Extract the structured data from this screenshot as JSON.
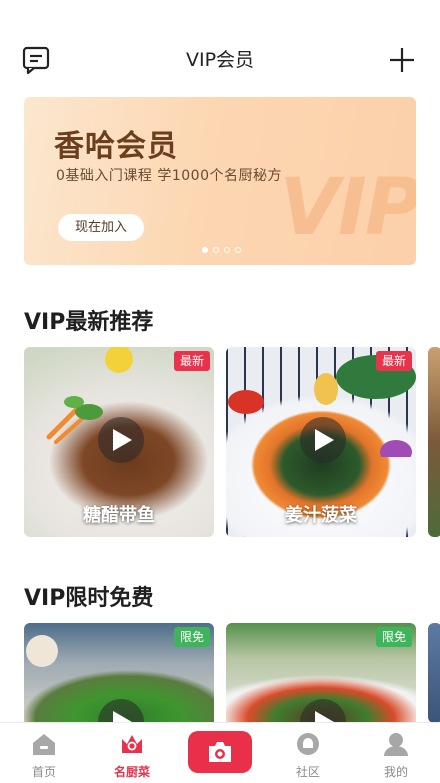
{
  "header": {
    "title": "VIP会员",
    "left_icon": "message-icon",
    "right_icon": "plus-icon"
  },
  "banner": {
    "title": "香哈会员",
    "subtitle": "0基础入门课程  学1000个名厨秘方",
    "button_label": "现在加入",
    "watermark": "VIP",
    "dots_count": 4,
    "active_dot": 0
  },
  "sections": [
    {
      "title": "VIP最新推荐",
      "cards": [
        {
          "label": "糖醋带鱼",
          "badge": "最新"
        },
        {
          "label": "姜汁菠菜",
          "badge": "最新"
        }
      ]
    },
    {
      "title": "VIP限时免费",
      "cards": [
        {
          "label": "",
          "badge": "限免"
        },
        {
          "label": "",
          "badge": "限免"
        }
      ]
    }
  ],
  "tabbar": {
    "items": [
      {
        "label": "首页",
        "icon": "home-icon"
      },
      {
        "label": "名厨菜",
        "icon": "chef-hat-icon",
        "active": true
      },
      {
        "label": "",
        "icon": "camera-icon"
      },
      {
        "label": "社区",
        "icon": "community-icon"
      },
      {
        "label": "我的",
        "icon": "profile-icon"
      }
    ]
  },
  "colors": {
    "accent": "#e9334d",
    "free_badge": "#3fb45a",
    "banner_title": "#6b3f1d"
  }
}
